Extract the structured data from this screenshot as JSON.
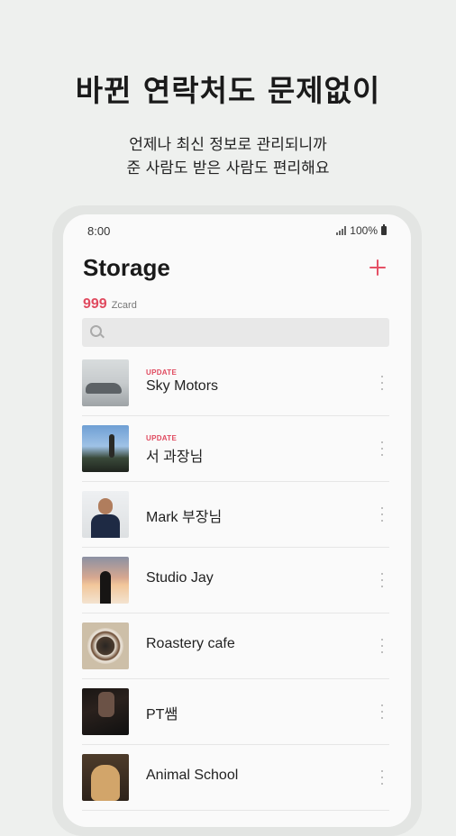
{
  "promo": {
    "headline": "바뀐 연락처도 문제없이",
    "subtitle_line1": "언제나 최신 정보로 관리되니까",
    "subtitle_line2": "준 사람도 받은 사람도 편리해요"
  },
  "status_bar": {
    "time": "8:00",
    "battery": "100%"
  },
  "header": {
    "title": "Storage",
    "add_icon": "plus-icon",
    "count": "999",
    "count_unit": "Zcard"
  },
  "search": {
    "placeholder": "",
    "icon": "search-icon"
  },
  "contacts": [
    {
      "name": "Sky Motors",
      "badge": "UPDATE"
    },
    {
      "name": "서 과장님",
      "badge": "UPDATE"
    },
    {
      "name": "Mark 부장님",
      "badge": ""
    },
    {
      "name": "Studio Jay",
      "badge": ""
    },
    {
      "name": "Roastery cafe",
      "badge": ""
    },
    {
      "name": "PT쌤",
      "badge": ""
    },
    {
      "name": "Animal School",
      "badge": ""
    }
  ],
  "colors": {
    "accent": "#e04a5f",
    "background": "#eef0ee",
    "screen": "#fafafa"
  }
}
